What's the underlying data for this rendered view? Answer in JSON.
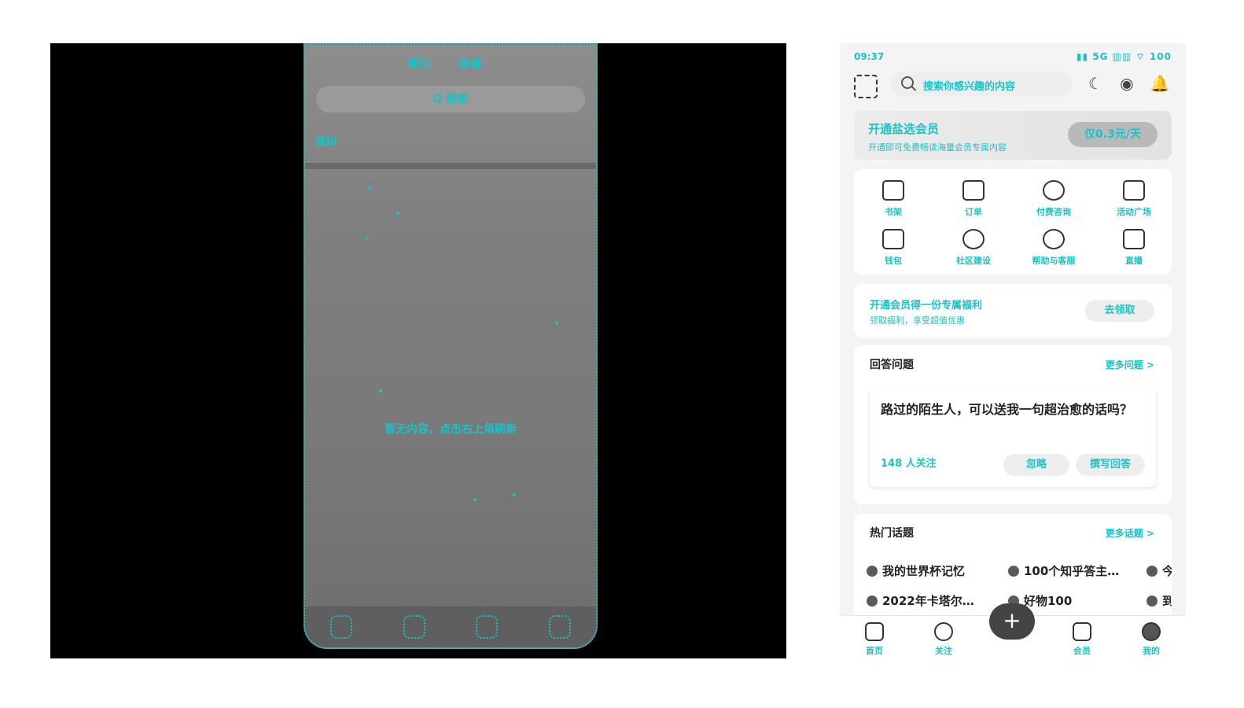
{
  "left_phone": {
    "tabs": [
      "關注",
      "推薦"
    ],
    "search_label": "Q 搜索",
    "row_label": "通知",
    "empty_text": "暂无内容，点击右上角刷新"
  },
  "status_bar": {
    "time": "09:37",
    "icons": "▮▮ 5G ▥▥ ⌔ 100"
  },
  "topbar": {
    "search_placeholder": "搜索你感兴趣的内容",
    "icons": [
      "scan-icon",
      "moon-icon",
      "camera-icon",
      "bell-icon"
    ]
  },
  "vip_card": {
    "title": "开通盐选会员",
    "subtitle": "开通即可免费畅读海量会员专属内容",
    "button": "仅0.3元/天"
  },
  "grid": {
    "items": [
      {
        "label": "书架",
        "icon": "bookshelf-icon"
      },
      {
        "label": "订单",
        "icon": "bag-icon"
      },
      {
        "label": "付费咨询",
        "icon": "consult-icon"
      },
      {
        "label": "活动广场",
        "icon": "flag-icon"
      },
      {
        "label": "钱包",
        "icon": "wallet-icon"
      },
      {
        "label": "社区建设",
        "icon": "community-icon"
      },
      {
        "label": "帮助与客服",
        "icon": "headset-icon"
      },
      {
        "label": "直播",
        "icon": "live-icon"
      }
    ]
  },
  "invite_card": {
    "title": "开通会员得一份专属福利",
    "subtitle": "领取福利，享受超值优惠",
    "button": "去领取"
  },
  "qa_section": {
    "title": "回答问题",
    "more": "更多问题 >",
    "question": "路过的陌生人，可以送我一句超治愈的话吗？",
    "meta": "148 人关注",
    "ignore_button": "忽略",
    "answer_button": "撰写回答"
  },
  "topic_section": {
    "title": "热门话题",
    "more": "更多话题 >",
    "topics_row1": [
      "我的世界杯记忆",
      "100个知乎答主…",
      "今"
    ],
    "topics_row2": [
      "2022年卡塔尔…",
      "好物100",
      "到"
    ]
  },
  "bottom_nav": {
    "items": [
      "首页",
      "关注",
      "会员",
      "我的"
    ],
    "fab": "+"
  }
}
